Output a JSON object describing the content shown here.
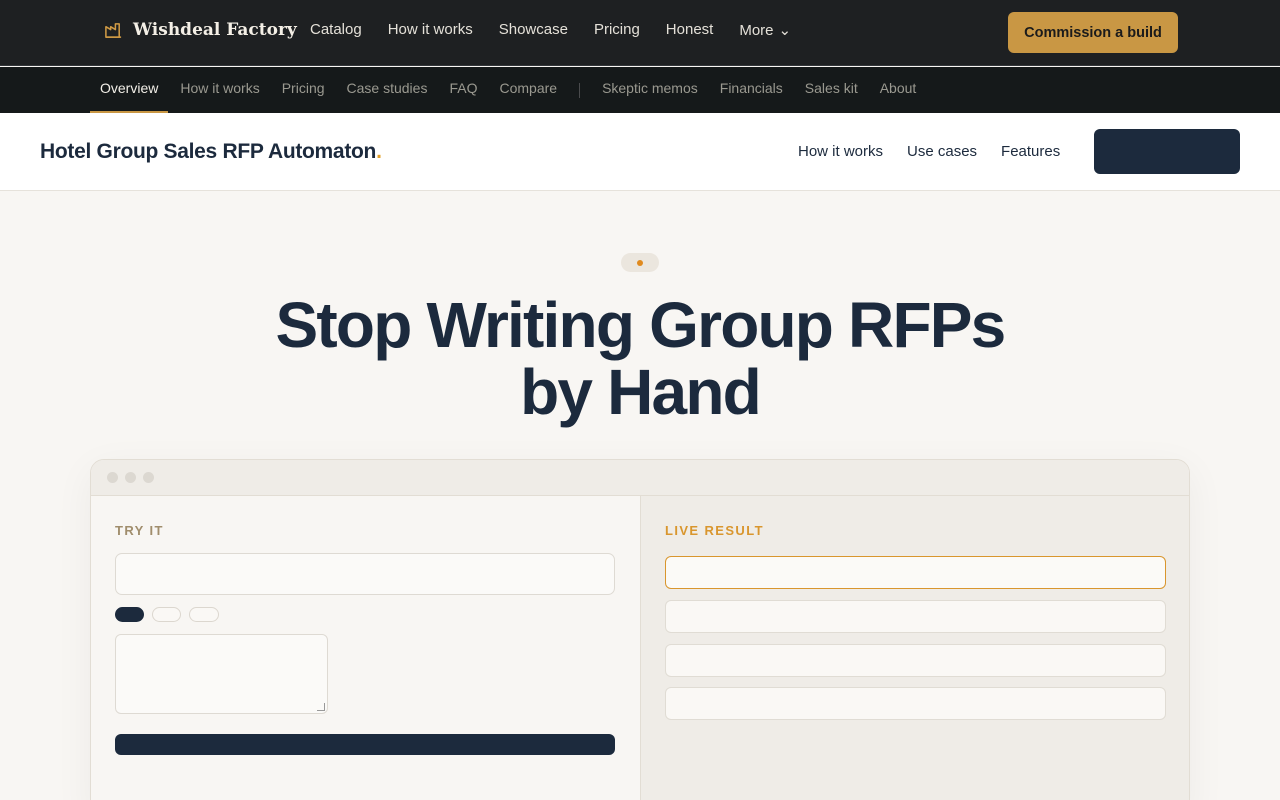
{
  "topbar": {
    "brand": "Wishdeal Factory",
    "nav": [
      "Catalog",
      "How it works",
      "Showcase",
      "Pricing",
      "Honest"
    ],
    "more_label": "More",
    "cta_label": "Commission a build"
  },
  "subnav": {
    "primary": [
      "Overview",
      "How it works",
      "Pricing",
      "Case studies",
      "FAQ",
      "Compare"
    ],
    "secondary": [
      "Skeptic memos",
      "Financials",
      "Sales kit",
      "About"
    ],
    "active": "Overview"
  },
  "product": {
    "title": "Hotel Group Sales RFP Automaton",
    "title_dot": ".",
    "nav": [
      "How it works",
      "Use cases",
      "Features"
    ],
    "button_label": ""
  },
  "hero": {
    "title_line1": "Stop Writing Group RFPs",
    "title_line2": "by Hand"
  },
  "demo": {
    "left_label": "TRY IT",
    "right_label": "LIVE RESULT",
    "input_value": "",
    "chips": 3,
    "selected_chip": 0,
    "result_rows": 4
  },
  "colors": {
    "accent": "#c99744",
    "navy": "#1c2a3d",
    "orange": "#e08a1e"
  }
}
